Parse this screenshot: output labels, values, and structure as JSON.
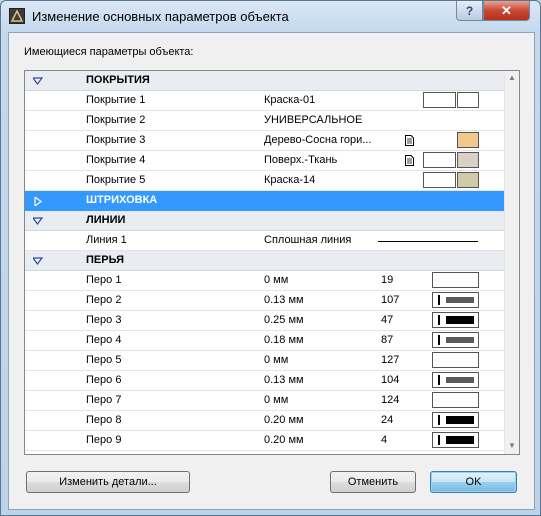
{
  "window": {
    "title": "Изменение основных параметров объекта",
    "help_label": "?",
    "close_label": "✕"
  },
  "group_label": "Имеющиеся параметры объекта:",
  "sections": {
    "coverings": "ПОКРЫТИЯ",
    "hatching": "ШТРИХОВКА",
    "lines": "ЛИНИИ",
    "pens": "ПЕРЬЯ"
  },
  "coverings": [
    {
      "name": "Покрытие 1",
      "value": "Краска-01",
      "doc_icon": false,
      "swatch1": "#ffffff",
      "swatch2": "#ffffff"
    },
    {
      "name": "Покрытие 2",
      "value": "УНИВЕРСАЛЬНОЕ",
      "doc_icon": false,
      "swatch1": null,
      "swatch2": null
    },
    {
      "name": "Покрытие 3",
      "value": "Дерево-Сосна гори...",
      "doc_icon": true,
      "swatch1": null,
      "swatch2": "#f1c98d"
    },
    {
      "name": "Покрытие 4",
      "value": "Поверх.-Ткань",
      "doc_icon": true,
      "swatch1": "#ffffff",
      "swatch2": "#d8d0c4"
    },
    {
      "name": "Покрытие 5",
      "value": "Краска-14",
      "doc_icon": false,
      "swatch1": "#ffffff",
      "swatch2": "#cfcba8"
    }
  ],
  "lines": [
    {
      "name": "Линия 1",
      "value": "Сплошная линия"
    }
  ],
  "pens": [
    {
      "name": "Перо 1",
      "value": "0 мм",
      "num": "19",
      "thickness": 0
    },
    {
      "name": "Перо 2",
      "value": "0.13 мм",
      "num": "107",
      "thickness": 1
    },
    {
      "name": "Перо 3",
      "value": "0.25 мм",
      "num": "47",
      "thickness": 2
    },
    {
      "name": "Перо 4",
      "value": "0.18 мм",
      "num": "87",
      "thickness": 1
    },
    {
      "name": "Перо 5",
      "value": "0 мм",
      "num": "127",
      "thickness": 0
    },
    {
      "name": "Перо 6",
      "value": "0.13 мм",
      "num": "104",
      "thickness": 1
    },
    {
      "name": "Перо 7",
      "value": "0 мм",
      "num": "124",
      "thickness": 0
    },
    {
      "name": "Перо 8",
      "value": "0.20 мм",
      "num": "24",
      "thickness": 2
    },
    {
      "name": "Перо 9",
      "value": "0.20 мм",
      "num": "4",
      "thickness": 2
    }
  ],
  "buttons": {
    "details": "Изменить детали...",
    "cancel": "Отменить",
    "ok": "OK"
  },
  "colors": {
    "selection": "#3399ff",
    "section_bg": "#e9ecf0",
    "pen_thin": "#5a5a5a",
    "pen_thick": "#000000"
  }
}
